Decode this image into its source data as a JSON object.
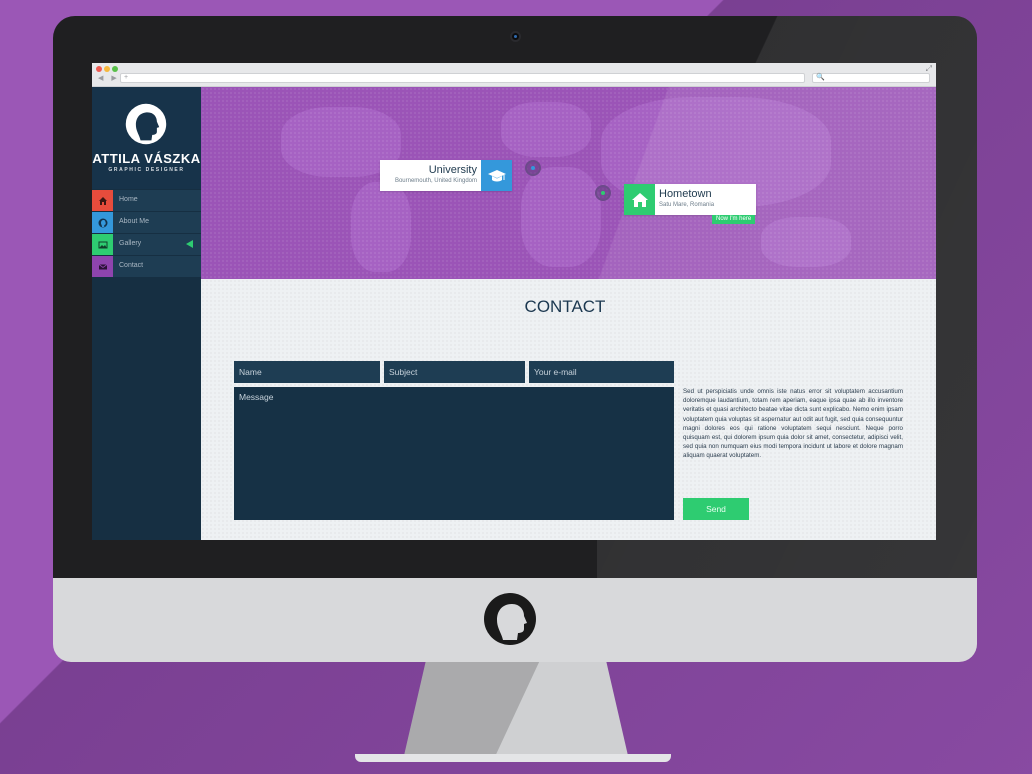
{
  "brand": {
    "name": "ATTILA VÁSZKA",
    "subtitle": "GRAPHIC DESIGNER"
  },
  "browser": {
    "url": "+",
    "search": "🔍",
    "nav_arrows": "◀ ▶"
  },
  "sidebar": {
    "items": [
      {
        "label": "Home",
        "icon": "home-icon",
        "color": "#e74c3c"
      },
      {
        "label": "About Me",
        "icon": "profile-icon",
        "color": "#3498db"
      },
      {
        "label": "Gallery",
        "icon": "image-icon",
        "color": "#2ecc71",
        "active": true
      },
      {
        "label": "Contact",
        "icon": "envelope-icon",
        "color": "#8e44ad"
      }
    ]
  },
  "map": {
    "university": {
      "title": "University",
      "subtitle": "Bournemouth, United Kingdom",
      "color": "#3498db",
      "icon": "graduation-cap-icon"
    },
    "hometown": {
      "title": "Hometown",
      "subtitle": "Satu Mare, Romania",
      "color": "#2ecc71",
      "icon": "house-icon",
      "badge": "Now I'm here"
    }
  },
  "contact": {
    "title": "CONTACT",
    "name_placeholder": "Name",
    "subject_placeholder": "Subject",
    "email_placeholder": "Your e-mail",
    "message_placeholder": "Message",
    "body": "Sed ut perspiciatis unde omnis iste natus error sit voluptatem accusantium doloremque laudantium, totam rem aperiam, eaque ipsa quae ab illo inventore veritatis et quasi architecto beatae vitae dicta sunt explicabo. Nemo enim ipsam voluptatem quia voluptas sit aspernatur aut odit aut fugit, sed quia consequuntur magni dolores eos qui ratione voluptatem sequi nesciunt. Neque porro quisquam est, qui dolorem ipsum quia dolor sit amet, consectetur, adipisci velit, sed quia non numquam eius modi tempora incidunt ut labore et dolore magnam aliquam quaerat voluptatem.",
    "send_label": "Send"
  }
}
